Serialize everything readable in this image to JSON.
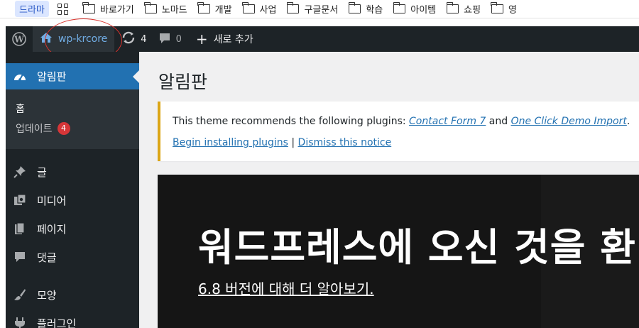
{
  "bookmarks": {
    "tag": "드라마",
    "folders": [
      "바로가기",
      "노마드",
      "개발",
      "사업",
      "구글문서",
      "학습",
      "아이템",
      "쇼핑",
      "영"
    ]
  },
  "adminbar": {
    "site_name": "wp-krcore",
    "updates_count": "4",
    "comments_count": "0",
    "new_label": "새로 추가"
  },
  "sidebar": {
    "active": "알림판",
    "sub_items": [
      {
        "label": "홈"
      },
      {
        "label": "업데이트",
        "badge": "4"
      }
    ],
    "items": [
      {
        "label": "글",
        "icon": "pin-icon"
      },
      {
        "label": "미디어",
        "icon": "media-icon"
      },
      {
        "label": "페이지",
        "icon": "page-icon"
      },
      {
        "label": "댓글",
        "icon": "comment-icon"
      },
      {
        "label": "모양",
        "icon": "brush-icon"
      },
      {
        "label": "플러그인",
        "icon": "plugin-icon"
      }
    ]
  },
  "main": {
    "title": "알림판",
    "notice": {
      "text_prefix": "This theme recommends the following plugins: ",
      "plugin1": "Contact Form 7",
      "and": " and ",
      "plugin2": "One Click Demo Import",
      "period": ".",
      "begin_link": "Begin installing plugins",
      "separator": " | ",
      "dismiss_link": "Dismiss this notice"
    },
    "welcome_title": "워드프레스에 오신 것을 환",
    "welcome_link": "6.8 버전에 대해 더 알아보기."
  },
  "colors": {
    "admin_bg": "#1d2327",
    "accent": "#2271b1",
    "notice_border": "#dba617",
    "badge": "#d63638",
    "annotation_circle": "#d9322c"
  }
}
